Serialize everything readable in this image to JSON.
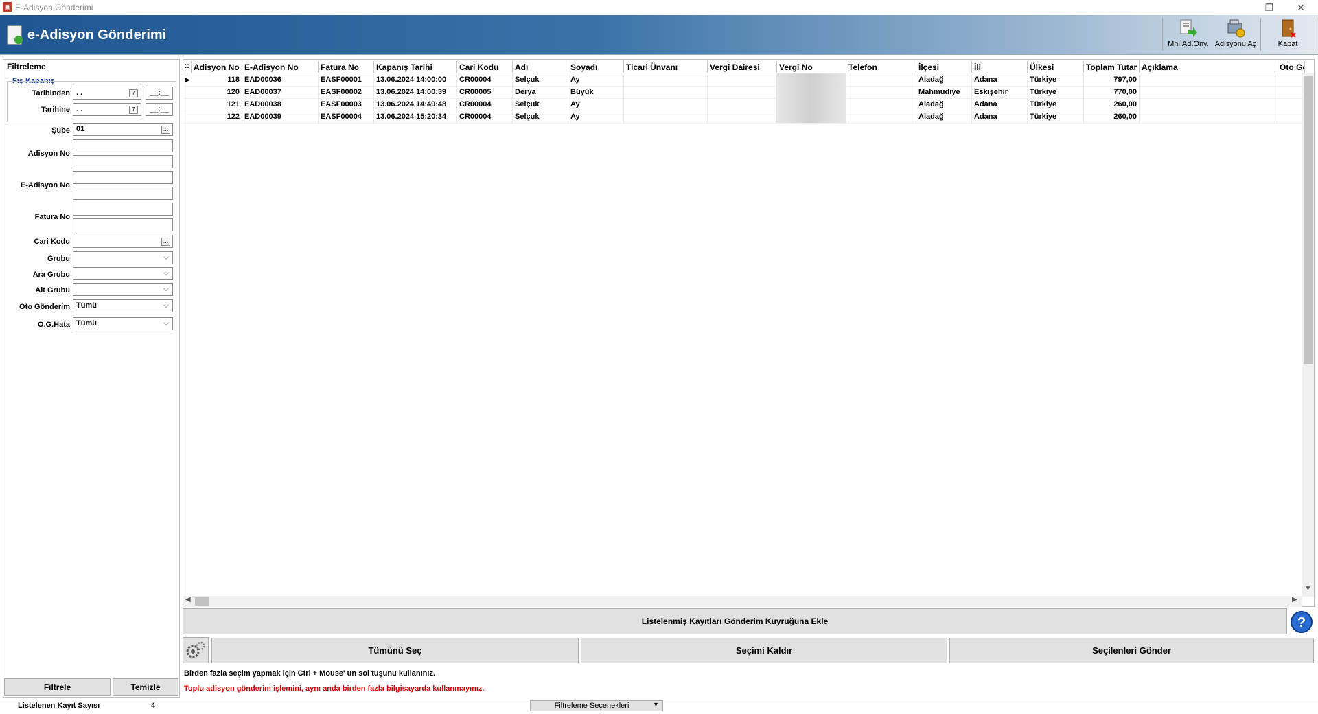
{
  "window": {
    "title": "E-Adisyon Gönderimi",
    "restore_icon": "restore-icon",
    "close_icon": "close-icon"
  },
  "banner": {
    "title": "e-Adisyon Gönderimi"
  },
  "toolbar": {
    "manual_label": "Mnl.Ad.Ony.",
    "open_label": "Adisyonu Aç",
    "close_label": "Kapat"
  },
  "filter": {
    "tab_label": "Filtreleme",
    "group_title": "Fiş Kapanış",
    "date_from_label": "Tarihinden",
    "date_from_value": " . .",
    "time_from_value": "__:__",
    "date_to_label": "Tarihine",
    "date_to_value": " . .",
    "time_to_value": "__:__",
    "branch_label": "Şube",
    "branch_value": "01",
    "adisyon_label": "Adisyon No",
    "eadisyon_label": "E-Adisyon No",
    "fatura_label": "Fatura No",
    "cari_label": "Cari Kodu",
    "grubu_label": "Grubu",
    "ara_grubu_label": "Ara Grubu",
    "alt_grubu_label": "Alt Grubu",
    "oto_label": "Oto Gönderim",
    "oto_value": "Tümü",
    "ogh_label": "O.G.Hata",
    "ogh_value": "Tümü",
    "filter_button": "Filtrele",
    "clear_button": "Temizle"
  },
  "grid": {
    "columns": [
      "Adisyon No",
      "E-Adisyon No",
      "Fatura No",
      "Kapanış Tarihi",
      "Cari Kodu",
      "Adı",
      "Soyadı",
      "Ticari Ünvanı",
      "Vergi Dairesi",
      "Vergi No",
      "Telefon",
      "İlçesi",
      "İli",
      "Ülkesi",
      "Toplam Tutar",
      "Açıklama",
      "Oto Gö"
    ],
    "rows": [
      {
        "adisyon_no": "118",
        "eadisyon_no": "EAD00036",
        "fatura_no": "EASF00001",
        "tarih": "13.06.2024 14:00:00",
        "cari": "CR00004",
        "adi": "Selçuk",
        "soyadi": "Ay",
        "ticari": "",
        "vergi_dairesi": "",
        "vergi_no": "",
        "telefon": "",
        "ilce": "Aladağ",
        "il": "Adana",
        "ulke": "Türkiye",
        "tutar": "797,00",
        "aciklama": "",
        "oto": ""
      },
      {
        "adisyon_no": "120",
        "eadisyon_no": "EAD00037",
        "fatura_no": "EASF00002",
        "tarih": "13.06.2024 14:00:39",
        "cari": "CR00005",
        "adi": "Derya",
        "soyadi": "Büyük",
        "ticari": "",
        "vergi_dairesi": "",
        "vergi_no": "",
        "telefon": "",
        "ilce": "Mahmudiye",
        "il": "Eskişehir",
        "ulke": "Türkiye",
        "tutar": "770,00",
        "aciklama": "",
        "oto": ""
      },
      {
        "adisyon_no": "121",
        "eadisyon_no": "EAD00038",
        "fatura_no": "EASF00003",
        "tarih": "13.06.2024 14:49:48",
        "cari": "CR00004",
        "adi": "Selçuk",
        "soyadi": "Ay",
        "ticari": "",
        "vergi_dairesi": "",
        "vergi_no": "",
        "telefon": "",
        "ilce": "Aladağ",
        "il": "Adana",
        "ulke": "Türkiye",
        "tutar": "260,00",
        "aciklama": "",
        "oto": ""
      },
      {
        "adisyon_no": "122",
        "eadisyon_no": "EAD00039",
        "fatura_no": "EASF00004",
        "tarih": "13.06.2024 15:20:34",
        "cari": "CR00004",
        "adi": "Selçuk",
        "soyadi": "Ay",
        "ticari": "",
        "vergi_dairesi": "",
        "vergi_no": "",
        "telefon": "",
        "ilce": "Aladağ",
        "il": "Adana",
        "ulke": "Türkiye",
        "tutar": "260,00",
        "aciklama": "",
        "oto": ""
      }
    ]
  },
  "actions": {
    "queue_button": "Listelenmiş Kayıtları Gönderim Kuyruğuna Ekle",
    "select_all": "Tümünü Seç",
    "deselect": "Seçimi Kaldır",
    "send_selected": "Seçilenleri Gönder",
    "info_line": "Birden fazla seçim yapmak için Ctrl + Mouse' un sol tuşunu kullanınız.",
    "warning_line": "Toplu adisyon gönderim işlemini, aynı anda birden fazla bilgisayarda kullanmayınız."
  },
  "status": {
    "count_label": "Listelenen Kayıt Sayısı",
    "count_value": "4",
    "filter_options": "Filtreleme Seçenekleri"
  },
  "colors": {
    "banner_start": "#1f5591",
    "warning_text": "#e00000",
    "group_title": "#1f3f9e"
  }
}
